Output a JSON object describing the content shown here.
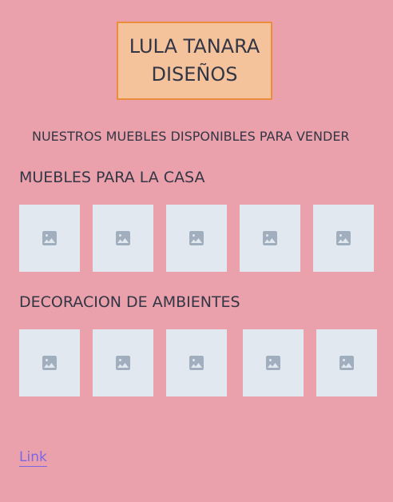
{
  "brand": {
    "line1": "LULA TANARA",
    "line2": "DISEÑOS"
  },
  "subtitle": "NUESTROS MUEBLES DISPONIBLES PARA VENDER",
  "sections": [
    {
      "title": "MUEBLES PARA LA CASA",
      "tile_count": 5,
      "tile_icon": "image-placeholder-icon"
    },
    {
      "title": "DECORACION DE AMBIENTES",
      "tile_count": 5,
      "tile_icon": "image-placeholder-icon"
    }
  ],
  "footer": {
    "link_label": "Link"
  },
  "colors": {
    "page_background": "#eaa1ab",
    "brand_fill": "#f5c39b",
    "brand_border": "#ee8c3e",
    "tile_background": "#e2e8f0",
    "icon": "#a0aebd",
    "link": "#7b67e6"
  }
}
